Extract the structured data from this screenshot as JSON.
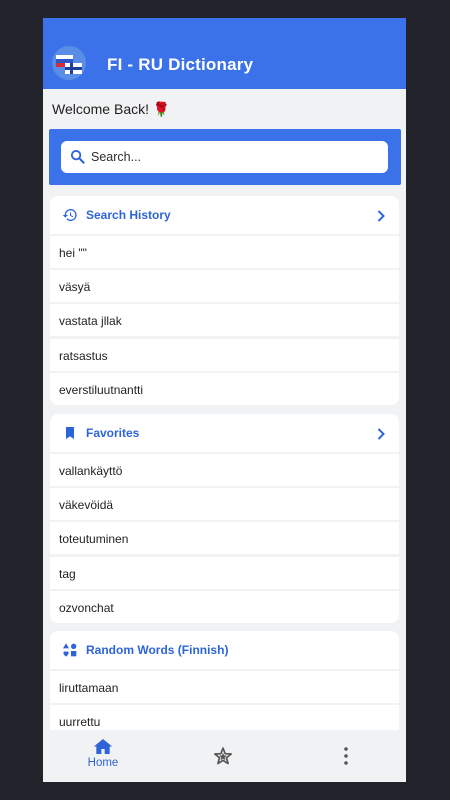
{
  "appbar": {
    "title": "FI - RU Dictionary",
    "logo_icon": "flags-logo-icon"
  },
  "welcome": "Welcome Back! 🌹",
  "search": {
    "placeholder": "Search..."
  },
  "history": {
    "title": "Search History",
    "items": [
      "hei \"\"",
      "väsyä",
      "vastata jllak",
      "ratsastus",
      "everstiluutnantti"
    ]
  },
  "favorites": {
    "title": "Favorites",
    "items": [
      "vallankäyttö",
      "väkevöidä",
      "toteutuminen",
      "tag",
      "ozvonchat"
    ]
  },
  "random": {
    "title": "Random Words (Finnish)",
    "items": [
      "liruttamaan",
      "uurrettu"
    ]
  },
  "nav": {
    "home_label": "Home"
  },
  "colors": {
    "accent": "#3b72ea",
    "link": "#2d64d8",
    "background": "#f1f2f4"
  }
}
